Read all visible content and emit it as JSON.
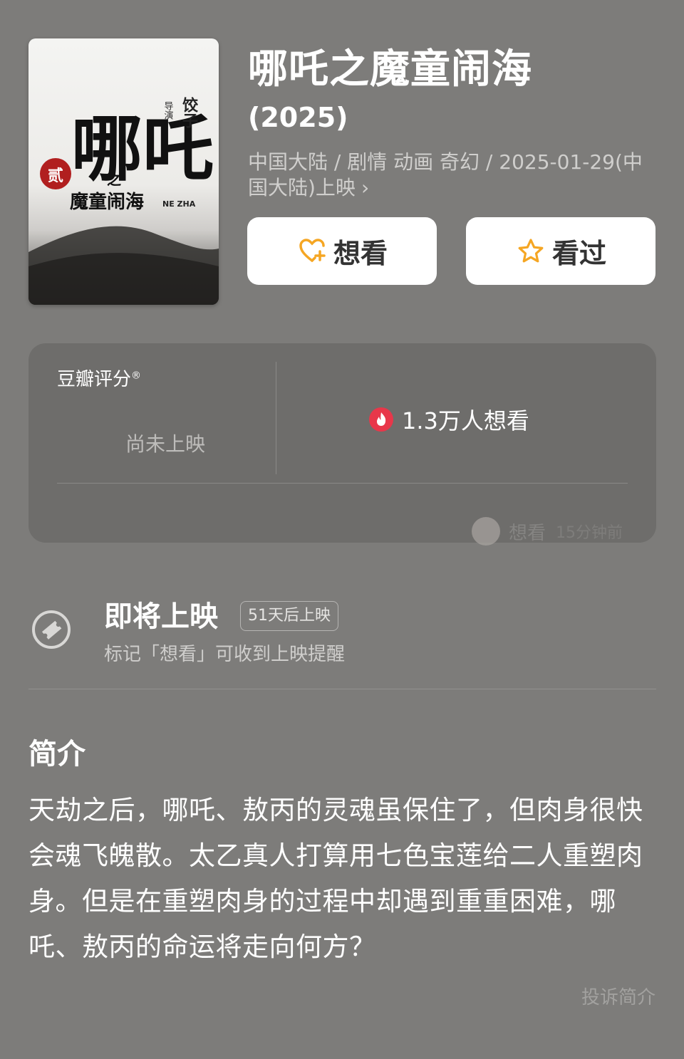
{
  "poster": {
    "calligraphy_main": "哪吒",
    "zhi": "之",
    "subtitle": "魔童闹海",
    "seal": "贰",
    "director_label": "导演",
    "director_name": "饺子",
    "latin": "NE ZHA"
  },
  "movie": {
    "title": "哪吒之魔童闹海",
    "year": "(2025)",
    "meta": "中国大陆 / 剧情 动画 奇幻 / 2025-01-29(中国大陆)上映",
    "meta_chevron": "›"
  },
  "actions": {
    "want_label": "想看",
    "seen_label": "看过"
  },
  "rating": {
    "title": "豆瓣评分",
    "trademark": "®",
    "status": "尚未上映",
    "want_count": "1.3万人想看",
    "activity_action": "想看",
    "activity_time": "15分钟前"
  },
  "upcoming": {
    "title": "即将上映",
    "badge": "51天后上映",
    "subtitle": "标记「想看」可收到上映提醒"
  },
  "intro": {
    "title": "简介",
    "text": "天劫之后，哪吒、敖丙的灵魂虽保住了，但肉身很快会魂飞魄散。太乙真人打算用七色宝莲给二人重塑肉身。但是在重塑肉身的过程中却遇到重重困难，哪吒、敖丙的命运将走向何方？",
    "report": "投诉简介"
  },
  "colors": {
    "background": "#7d7c7a",
    "card": "#6e6d6b",
    "accent_orange": "#f5a623",
    "fire_red": "#e8374a"
  },
  "icons": {
    "want": "heart-plus-icon",
    "seen": "star-icon",
    "fire": "fire-icon",
    "ticket": "ticket-icon"
  }
}
